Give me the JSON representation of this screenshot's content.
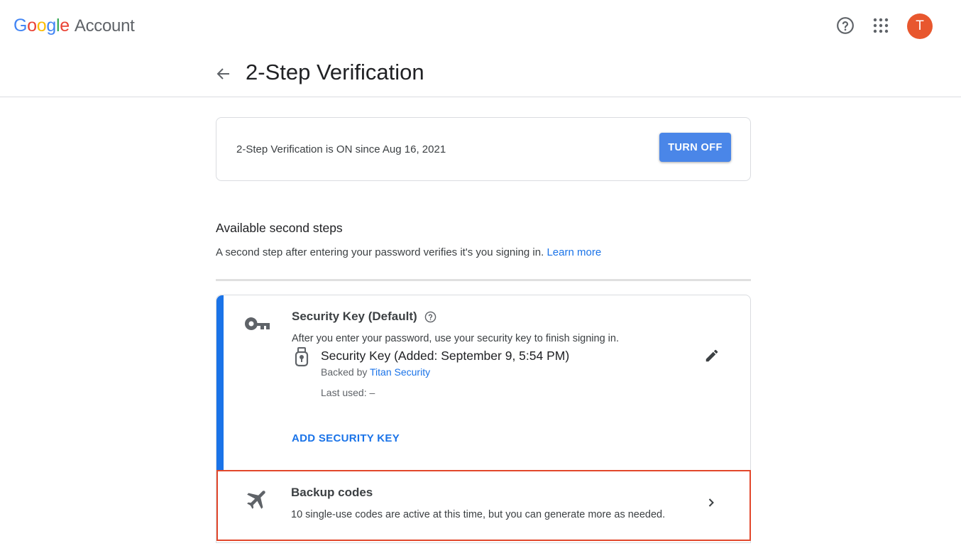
{
  "header": {
    "logo_google": [
      "G",
      "o",
      "o",
      "g",
      "l",
      "e"
    ],
    "logo_account": "Account",
    "avatar_letter": "T",
    "icons": [
      "help-circle-icon",
      "apps-grid-icon"
    ]
  },
  "page": {
    "title": "2-Step Verification",
    "back_icon": "arrow-back-icon"
  },
  "status": {
    "text": "2-Step Verification is ON since Aug 16, 2021",
    "turn_off_label": "TURN OFF"
  },
  "section": {
    "title": "Available second steps",
    "description": "A second step after entering your password verifies it's you signing in.",
    "learn_more": "Learn more"
  },
  "security_key": {
    "title": "Security Key (Default)",
    "description": "After you enter your password, use your security key to finish signing in.",
    "key_name": "Security Key (Added: September 9, 5:54 PM)",
    "backed_by_prefix": "Backed by",
    "backed_by_link": "Titan Security",
    "last_used": "Last used: –",
    "add_label": "ADD SECURITY KEY"
  },
  "backup_codes": {
    "title": "Backup codes",
    "description": "10 single-use codes are active at this time, but you can generate more as needed."
  },
  "colors": {
    "accent": "#1a73e8",
    "button_blue": "#4a86e8",
    "avatar": "#e8572e",
    "highlight_border": "#e2472b"
  }
}
